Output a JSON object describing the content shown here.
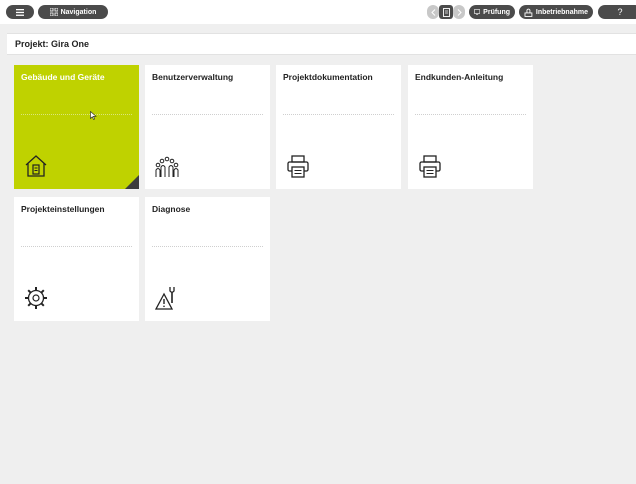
{
  "toolbar": {
    "menu_icon": "menu-icon",
    "navigation_label": "Navigation",
    "back_icon": "arrow-left-icon",
    "document_icon": "document-icon",
    "forward_icon": "arrow-right-icon",
    "pruefung_label": "Prüfung",
    "inbetriebnahme_label": "Inbetriebnahme",
    "help_label": "?"
  },
  "header": {
    "title": "Projekt: Gira One"
  },
  "tiles": [
    {
      "label": "Gebäude und Geräte",
      "icon": "house-icon",
      "active": true
    },
    {
      "label": "Benutzerverwaltung",
      "icon": "users-icon",
      "active": false
    },
    {
      "label": "Projektdokumentation",
      "icon": "printer-icon",
      "active": false
    },
    {
      "label": "Endkunden-Anleitung",
      "icon": "printer-icon",
      "active": false
    },
    {
      "label": "Projekteinstellungen",
      "icon": "gear-icon",
      "active": false
    },
    {
      "label": "Diagnose",
      "icon": "diagnose-icon",
      "active": false
    }
  ],
  "colors": {
    "accent": "#bfd200",
    "pill": "#4b4b4b",
    "background": "#efefef"
  }
}
